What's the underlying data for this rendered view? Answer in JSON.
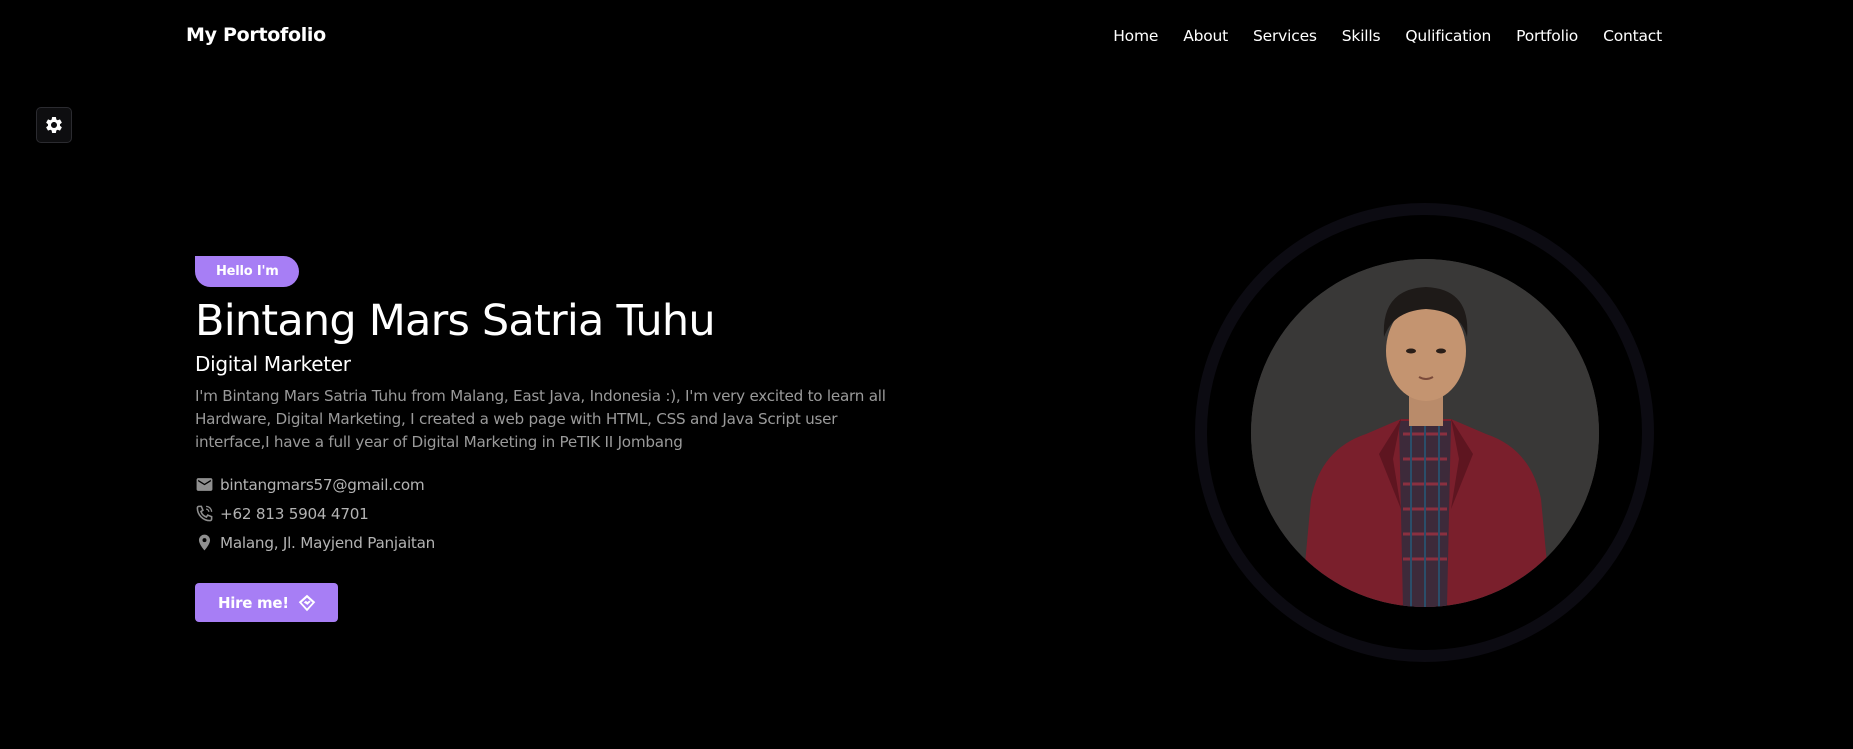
{
  "brand": "My Portofolio",
  "nav": [
    {
      "label": "Home"
    },
    {
      "label": "About"
    },
    {
      "label": "Services"
    },
    {
      "label": "Skills"
    },
    {
      "label": "Qulification"
    },
    {
      "label": "Portfolio"
    },
    {
      "label": "Contact"
    }
  ],
  "settings": {
    "icon": "gear-icon"
  },
  "hero": {
    "greeting": "Hello I'm",
    "name": "Bintang Mars Satria Tuhu",
    "role": "Digital Marketer",
    "description": "I'm Bintang Mars Satria Tuhu from Malang, East Java, Indonesia :), I'm very excited to learn all Hardware, Digital Marketing, I created a web page with HTML, CSS and Java Script user interface,I have a full year of Digital Marketing in PeTIK II Jombang",
    "contacts": [
      {
        "icon": "mail-icon",
        "text": "bintangmars57@gmail.com"
      },
      {
        "icon": "phone-icon",
        "text": "+62 813 5904 4701"
      },
      {
        "icon": "location-pin-icon",
        "text": "Malang, Jl. Mayjend Panjaitan"
      }
    ],
    "hire_label": "Hire me!",
    "hire_icon": "handshake-icon"
  },
  "colors": {
    "background": "#000000",
    "accent": "#a77ef5",
    "muted_text": "#9a9a9a",
    "ring": "#0c0b12",
    "jacket": "#7a1f2c"
  }
}
